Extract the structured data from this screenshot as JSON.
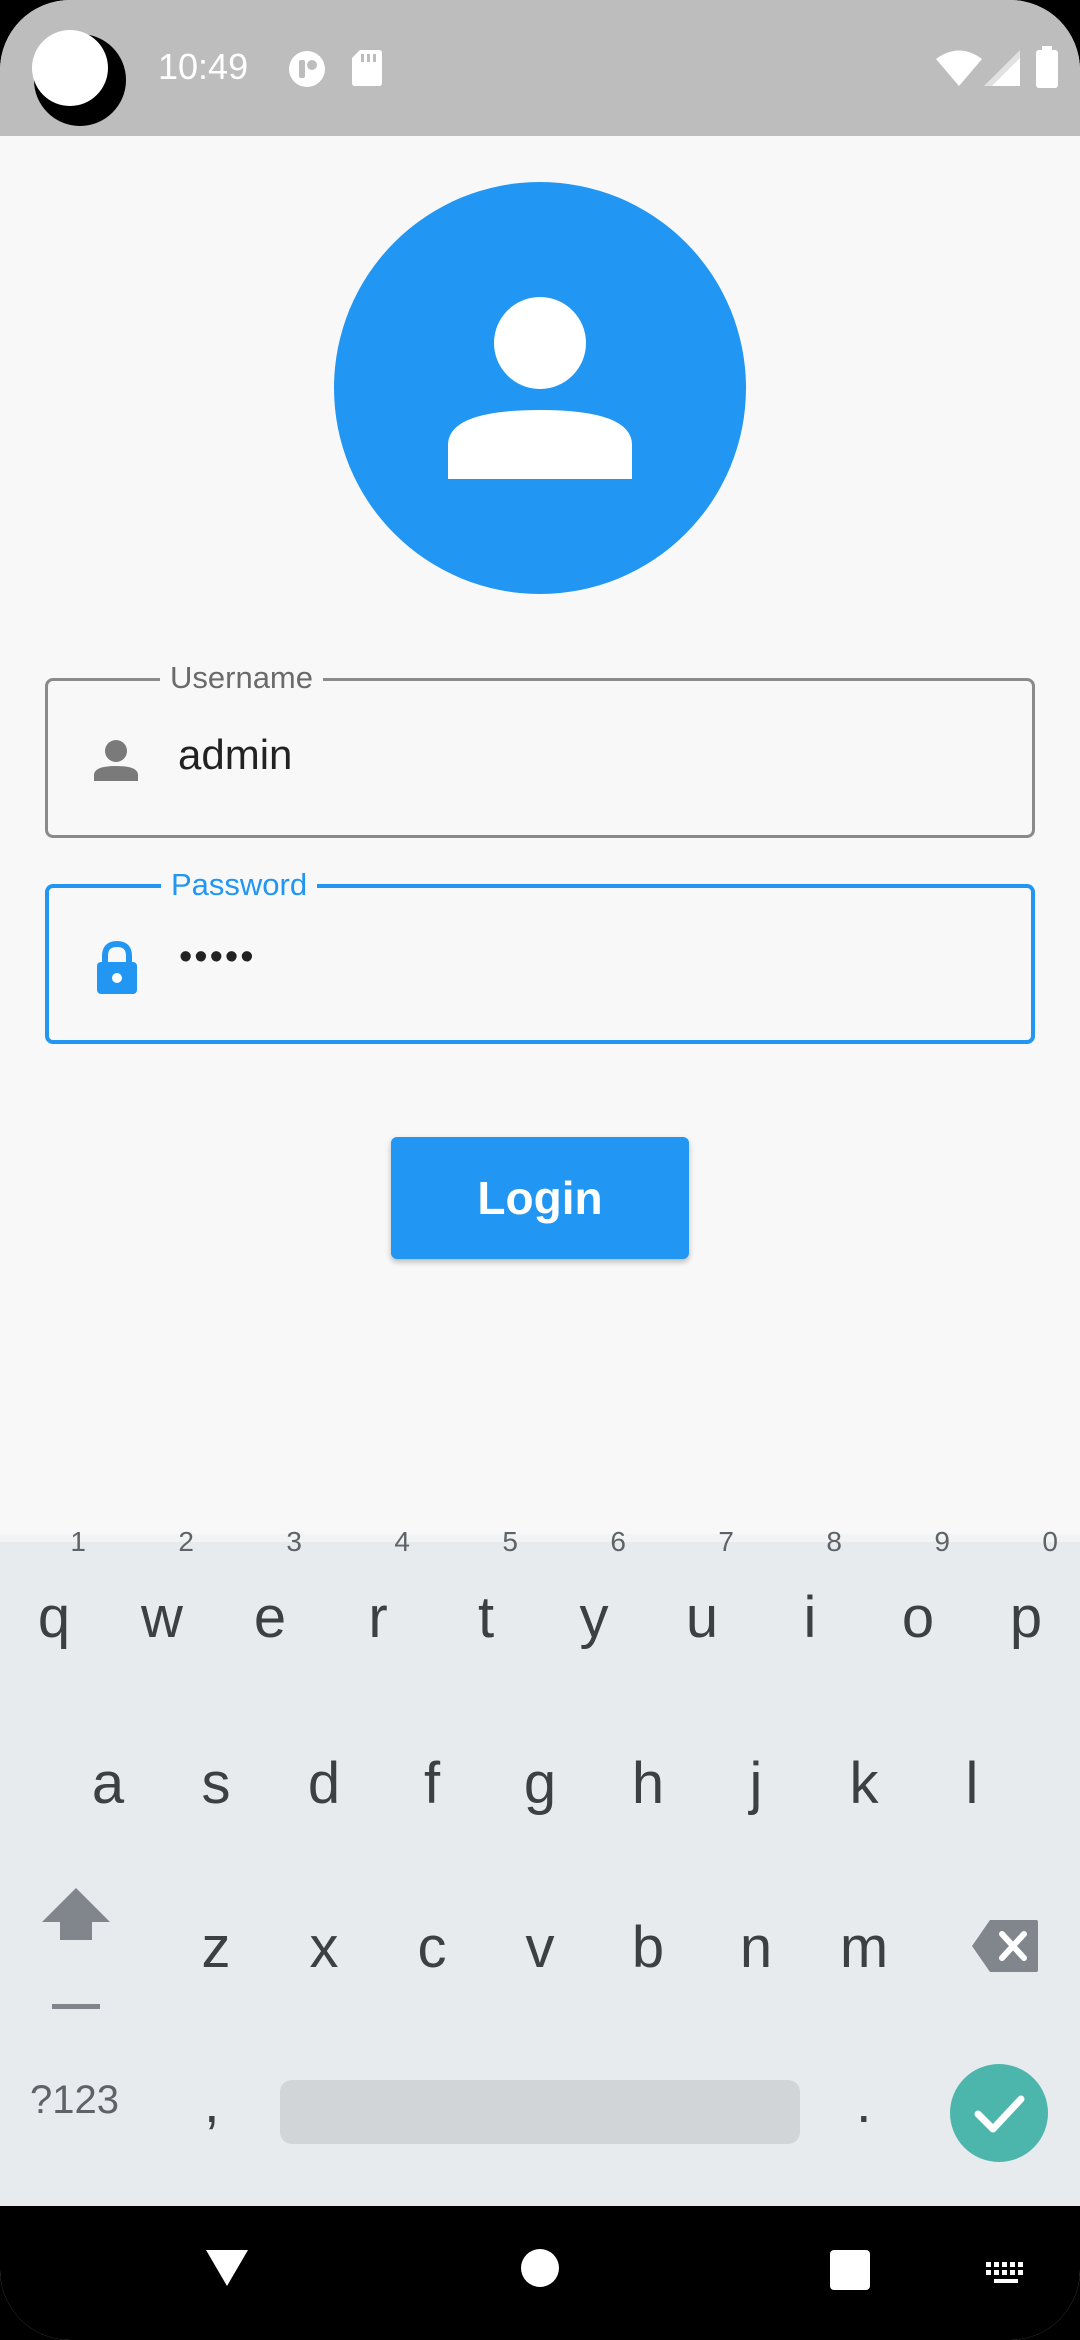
{
  "status_bar": {
    "time": "10:49",
    "icons": [
      "notification-app-icon",
      "sd-card-icon",
      "wifi-icon",
      "cellular-signal-icon",
      "battery-icon"
    ]
  },
  "form": {
    "avatar_icon": "person-icon",
    "username": {
      "label": "Username",
      "value": "admin",
      "icon": "person-icon"
    },
    "password": {
      "label": "Password",
      "value": "•••••",
      "icon": "lock-icon"
    },
    "login_label": "Login"
  },
  "colors": {
    "primary": "#2196f3",
    "status_bar": "#bdbdbd",
    "background": "#f8f8f8",
    "keyboard": "#e8ebee",
    "enter_key": "#4db6ac"
  },
  "keyboard": {
    "row1": [
      {
        "key": "q",
        "hint": "1"
      },
      {
        "key": "w",
        "hint": "2"
      },
      {
        "key": "e",
        "hint": "3"
      },
      {
        "key": "r",
        "hint": "4"
      },
      {
        "key": "t",
        "hint": "5"
      },
      {
        "key": "y",
        "hint": "6"
      },
      {
        "key": "u",
        "hint": "7"
      },
      {
        "key": "i",
        "hint": "8"
      },
      {
        "key": "o",
        "hint": "9"
      },
      {
        "key": "p",
        "hint": "0"
      }
    ],
    "row2": [
      "a",
      "s",
      "d",
      "f",
      "g",
      "h",
      "j",
      "k",
      "l"
    ],
    "row3": [
      "z",
      "x",
      "c",
      "v",
      "b",
      "n",
      "m"
    ],
    "symbols_label": "?123",
    "comma": ",",
    "period": "."
  }
}
